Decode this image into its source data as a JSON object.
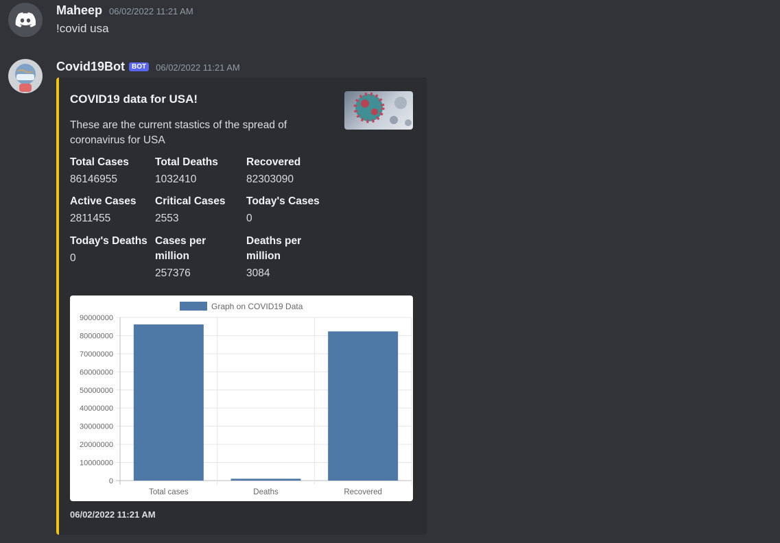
{
  "messages": [
    {
      "username": "Maheep",
      "timestamp": "06/02/2022 11:21 AM",
      "content": "!covid usa"
    },
    {
      "username": "Covid19Bot",
      "badge": "BOT",
      "timestamp": "06/02/2022 11:21 AM"
    }
  ],
  "embed": {
    "accent_color": "#f1c40f",
    "title": "COVID19 data for USA!",
    "description": "These are the current stastics of the spread of coronavirus for USA",
    "fields": [
      {
        "name": "Total Cases",
        "value": "86146955"
      },
      {
        "name": "Total Deaths",
        "value": "1032410"
      },
      {
        "name": "Recovered",
        "value": "82303090"
      },
      {
        "name": "Active Cases",
        "value": "2811455"
      },
      {
        "name": "Critical Cases",
        "value": "2553"
      },
      {
        "name": "Today's Cases",
        "value": "0"
      },
      {
        "name": "Today's Deaths",
        "value": "0"
      },
      {
        "name": "Cases per million",
        "value": "257376"
      },
      {
        "name": "Deaths per million",
        "value": "3084"
      }
    ],
    "footer": "06/02/2022 11:21 AM"
  },
  "chart_data": {
    "type": "bar",
    "categories": [
      "Total cases",
      "Deaths",
      "Recovered"
    ],
    "series": [
      {
        "name": "Graph on COVID19 Data",
        "values": [
          86146955,
          1032410,
          82303090
        ],
        "color": "#4e79a7"
      }
    ],
    "yticks": [
      "0",
      "10000000",
      "20000000",
      "30000000",
      "40000000",
      "50000000",
      "60000000",
      "70000000",
      "80000000",
      "90000000"
    ],
    "ylim": [
      0,
      90000000
    ],
    "legend": "top-center",
    "grid": true
  }
}
